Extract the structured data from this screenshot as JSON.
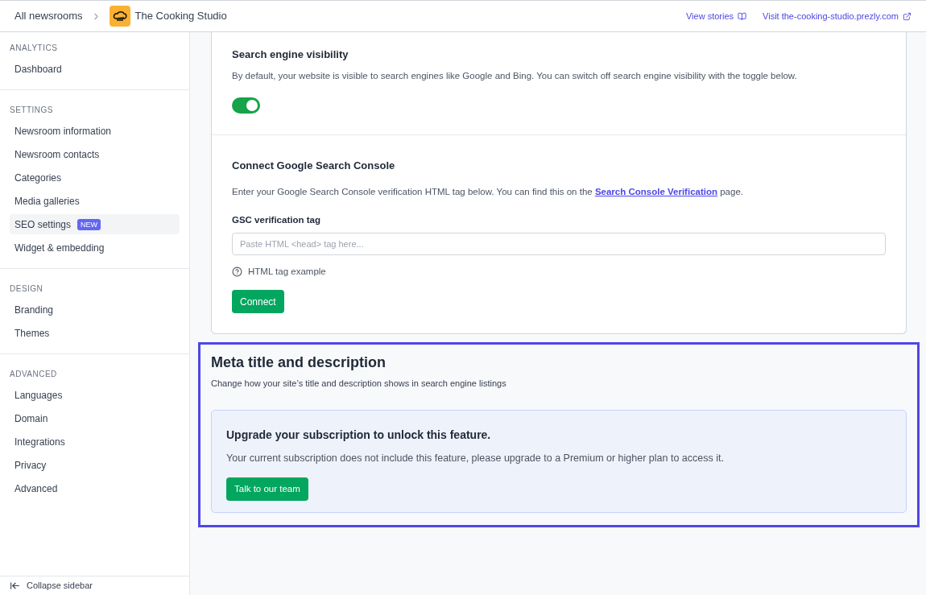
{
  "header": {
    "breadcrumb_root": "All newsrooms",
    "newsroom": "The Cooking Studio",
    "links": [
      {
        "kind": "book",
        "label": "View stories"
      },
      {
        "kind": "external",
        "label": "Visit the-cooking-studio.prezly.com"
      }
    ]
  },
  "sidebar": {
    "sections": [
      {
        "heading": "ANALYTICS",
        "items": [
          {
            "label": "Dashboard",
            "selected": false
          }
        ]
      },
      {
        "heading": "SETTINGS",
        "items": [
          {
            "label": "Newsroom information",
            "selected": false
          },
          {
            "label": "Newsroom contacts",
            "selected": false
          },
          {
            "label": "Categories",
            "selected": false
          },
          {
            "label": "Media galleries",
            "selected": false
          },
          {
            "label": "SEO settings",
            "selected": true,
            "badge": "NEW"
          },
          {
            "label": "Widget & embedding",
            "selected": false
          }
        ]
      },
      {
        "heading": "DESIGN",
        "items": [
          {
            "label": "Branding",
            "selected": false
          },
          {
            "label": "Themes",
            "selected": false
          }
        ]
      },
      {
        "heading": "ADVANCED",
        "items": [
          {
            "label": "Languages",
            "selected": false
          },
          {
            "label": "Domain",
            "selected": false
          },
          {
            "label": "Integrations",
            "selected": false
          },
          {
            "label": "Privacy",
            "selected": false
          },
          {
            "label": "Advanced",
            "selected": false
          }
        ]
      }
    ],
    "collapse": "Collapse sidebar"
  },
  "visibility": {
    "title": "Search engine visibility",
    "description": "By default, your website is visible to search engines like Google and Bing. You can switch off search engine visibility with the toggle below.",
    "on": true
  },
  "gsc": {
    "title": "Connect Google Search Console",
    "text_before": "Enter your Google Search Console verification HTML tag below. You can find this on the",
    "link": "Search Console Verification",
    "text_after": "page.",
    "field_label": "GSC verification tag",
    "placeholder": "Paste HTML <head> tag here...",
    "help": "HTML tag example",
    "button": "Connect"
  },
  "meta": {
    "title": "Meta title and description",
    "subtitle": "Change how your site’s title and description shows in search engine listings",
    "upgrade_title": "Upgrade your subscription to unlock this feature.",
    "upgrade_text": "Your current subscription does not include this feature, please upgrade to a Premium or higher plan to access it.",
    "button": "Talk to our team"
  }
}
